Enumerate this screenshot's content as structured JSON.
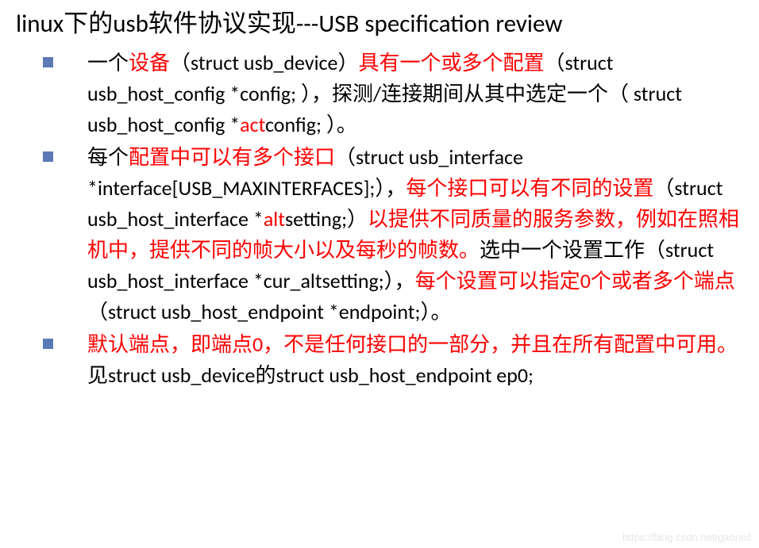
{
  "title": "linux下的usb软件协议实现---USB specification review",
  "bullets": [
    {
      "segments": [
        {
          "t": "一个",
          "r": false
        },
        {
          "t": "设备",
          "r": true
        },
        {
          "t": "（struct usb_device）",
          "r": false
        },
        {
          "t": "具有一个或多个配置",
          "r": true
        },
        {
          "t": "（struct usb_host_config *config; ），探测/连接期间从其中选定一个（ struct usb_host_config *",
          "r": false
        },
        {
          "t": "act",
          "r": true
        },
        {
          "t": "config; ）。",
          "r": false
        }
      ]
    },
    {
      "segments": [
        {
          "t": "每个",
          "r": false
        },
        {
          "t": "配置中可以有多个接口",
          "r": true
        },
        {
          "t": "（struct usb_interface *interface[USB_MAXINTERFACES];），",
          "r": false
        },
        {
          "t": "每个接口可以有不同的设置",
          "r": true
        },
        {
          "t": "（struct usb_host_interface *",
          "r": false
        },
        {
          "t": "alt",
          "r": true
        },
        {
          "t": "setting;）",
          "r": false
        },
        {
          "t": "以提供不同质量的服务参数，例如在照相机中，提供不同的帧大小以及每秒的帧数。",
          "r": true
        },
        {
          "t": "选中一个设置工作（struct usb_host_interface *cur_altsetting;），",
          "r": false
        },
        {
          "t": "每个设置可以指定0个或者多个端点",
          "r": true
        },
        {
          "t": "（struct usb_host_endpoint *endpoint;）。",
          "r": false
        }
      ]
    },
    {
      "segments": [
        {
          "t": "默认端点，即端点0，不是任何接口的一部分，并且在所有配置中可用。",
          "r": true
        },
        {
          "t": "见struct usb_device的struct usb_host_endpoint ep0;",
          "r": false
        }
      ]
    }
  ],
  "watermark": "https://blog.csdn.net/gaoneil"
}
